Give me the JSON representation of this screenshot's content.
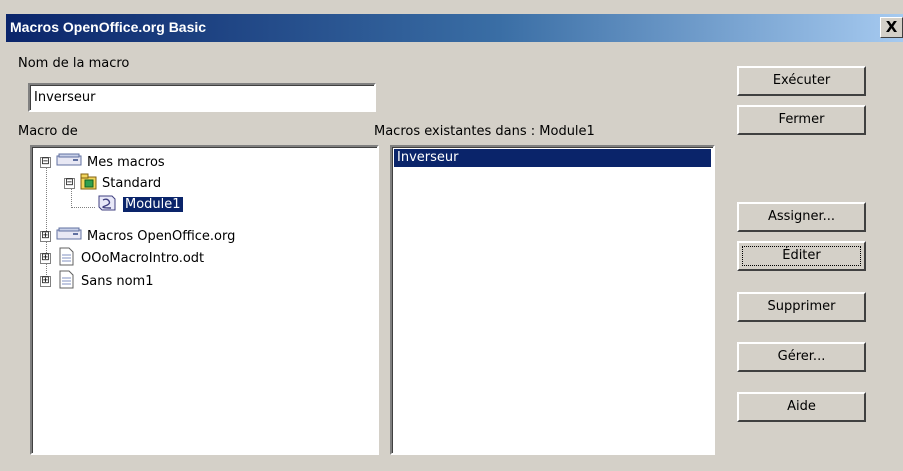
{
  "window": {
    "title": "Macros OpenOffice.org Basic",
    "close_label": "X"
  },
  "macro_name": {
    "label": "Nom de la macro",
    "value": "Inverseur"
  },
  "macro_from": {
    "label": "Macro de"
  },
  "existing": {
    "label": "Macros existantes dans : Module1",
    "items": [
      "Inverseur"
    ]
  },
  "tree": [
    {
      "label": "Mes macros",
      "expander": "⊟",
      "icon": "library-drive-icon"
    },
    {
      "label": "Standard",
      "expander": "⊟",
      "icon": "basic-library-icon"
    },
    {
      "label": "Module1",
      "icon": "basic-module-icon",
      "selected": true
    },
    {
      "label": "Macros OpenOffice.org",
      "expander": "⊞",
      "icon": "library-drive-icon"
    },
    {
      "label": "OOoMacroIntro.odt",
      "expander": "⊞",
      "icon": "document-icon"
    },
    {
      "label": "Sans nom1",
      "expander": "⊞",
      "icon": "document-icon"
    }
  ],
  "buttons": {
    "run": "Exécuter",
    "close": "Fermer",
    "assign": "Assigner...",
    "edit": "Éditer",
    "delete": "Supprimer",
    "manage": "Gérer...",
    "help": "Aide"
  },
  "colors": {
    "titlebar": "#0a246a",
    "selection": "#0a246a",
    "dialog_bg": "#d4d0c8"
  }
}
